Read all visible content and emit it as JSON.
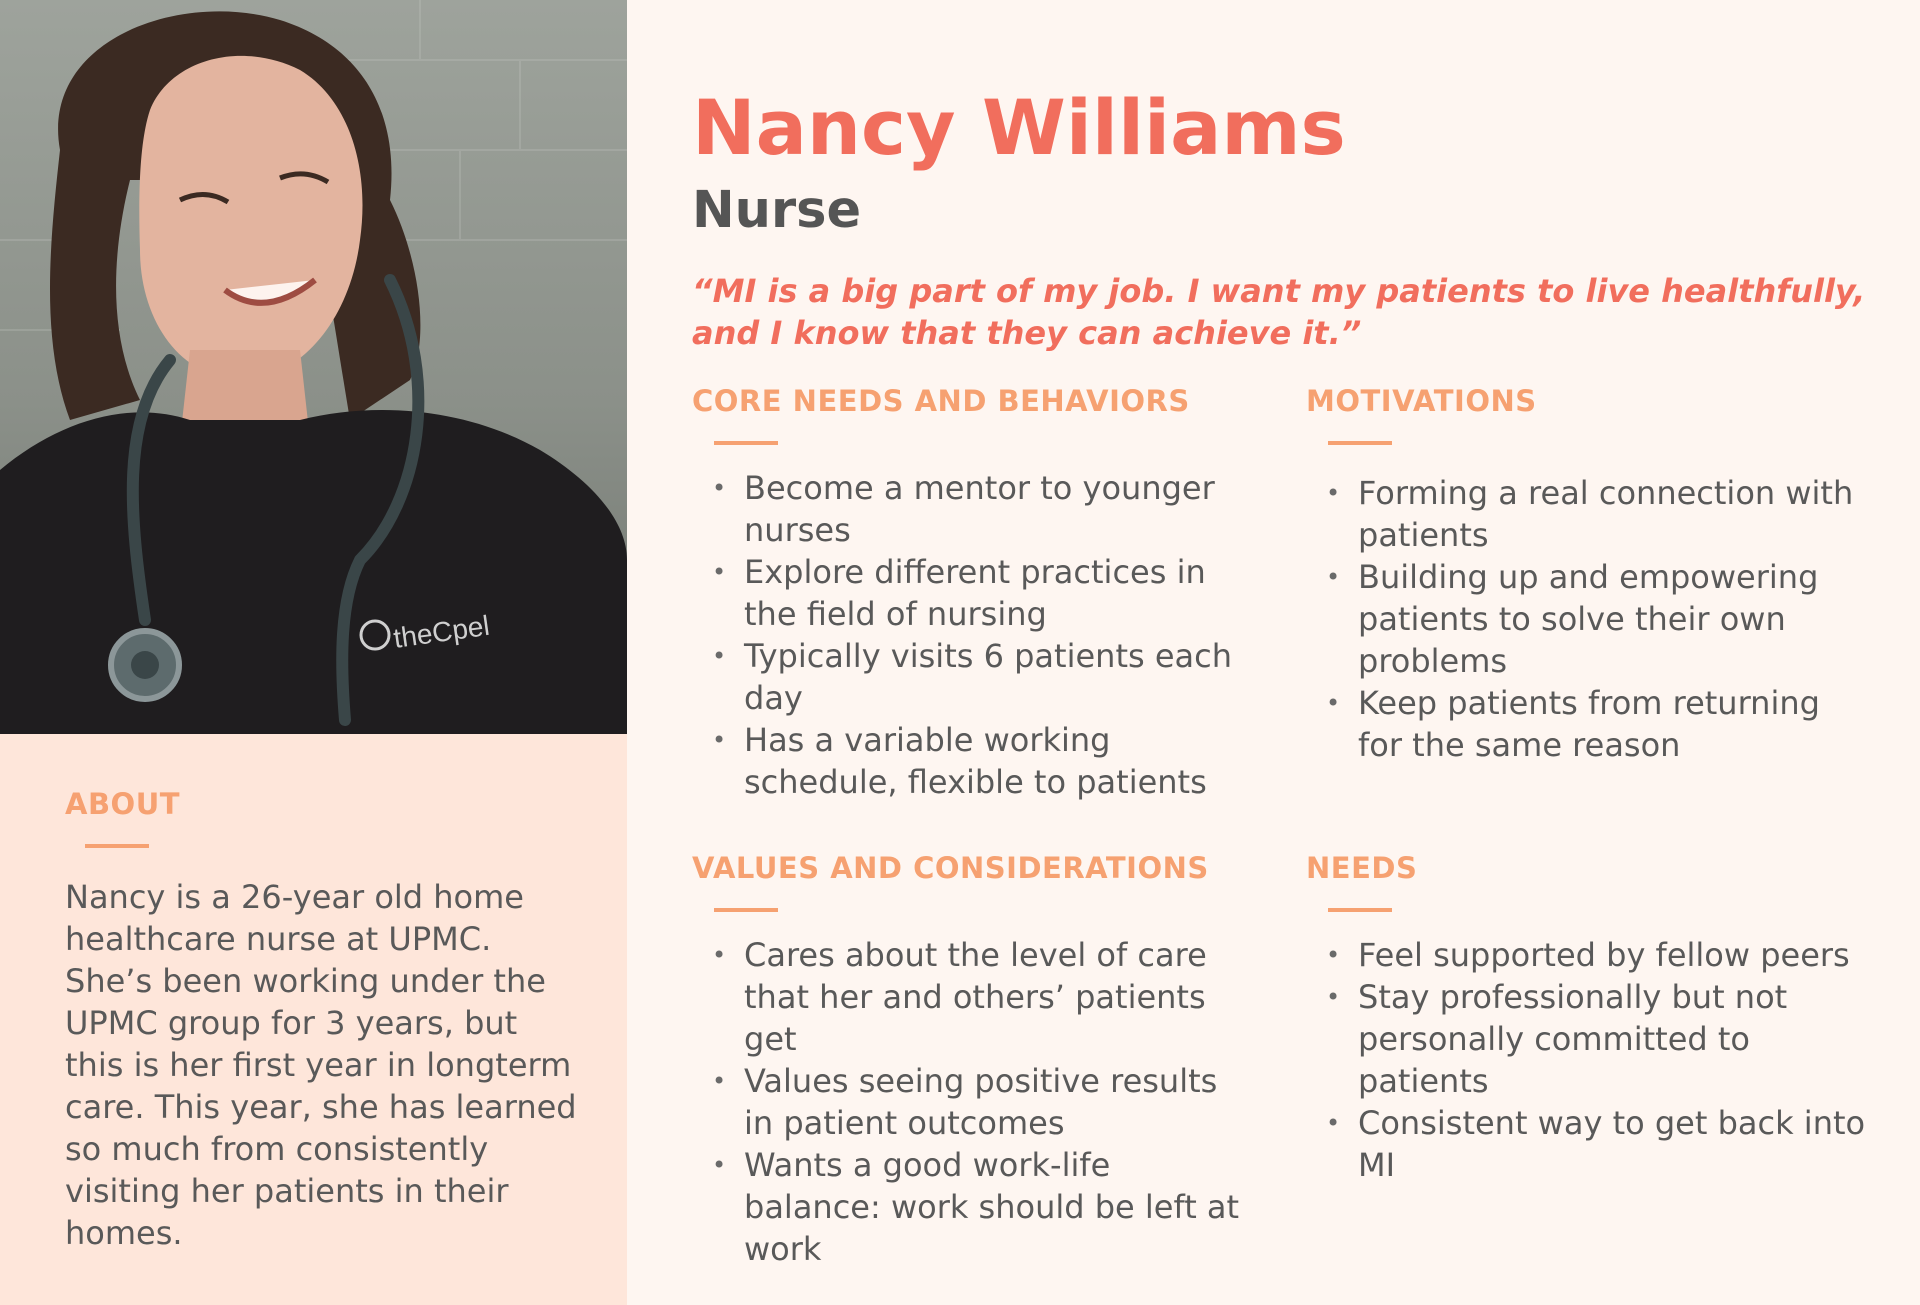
{
  "persona": {
    "name": "Nancy Williams",
    "role": "Nurse",
    "quote": "“MI is a big part of my job. I want my patients to live healthfully, and I know that they can achieve it.”"
  },
  "photo": {
    "shirt_print": "theCpel"
  },
  "about": {
    "title": "ABOUT",
    "text": "Nancy is a 26-year old home healthcare nurse at UPMC. She’s been working under the UPMC group for 3 years, but this is her first year in longterm care. This year, she has learned so much from consistently visiting her patients in their homes."
  },
  "sections": {
    "core": {
      "title": "CORE NEEDS AND BEHAVIORS",
      "items": [
        "Become a mentor to younger nurses",
        "Explore different practices in the field of nursing",
        "Typically visits 6 patients each day",
        "Has a variable working schedule, flexible to patients"
      ]
    },
    "motivations": {
      "title": "MOTIVATIONS",
      "items": [
        "Forming a real connection with patients",
        "Building up and empowering patients to solve their own problems",
        "Keep patients from returning for the same reason"
      ]
    },
    "values": {
      "title": "VALUES AND CONSIDERATIONS",
      "items": [
        "Cares about the level of care that her and others’ patients get",
        "Values seeing positive results in patient outcomes",
        "Wants a good work-life balance: work should be left at work"
      ]
    },
    "needs": {
      "title": "NEEDS",
      "items": [
        "Feel supported by fellow peers",
        "Stay professionally but not personally committed to patients",
        "Consistent way to get back into MI"
      ]
    }
  },
  "colors": {
    "accent": "#f16e5d",
    "section_title": "#f6a171",
    "text": "#595959",
    "page_bg": "#fef6f1",
    "about_bg": "#fee6da"
  }
}
